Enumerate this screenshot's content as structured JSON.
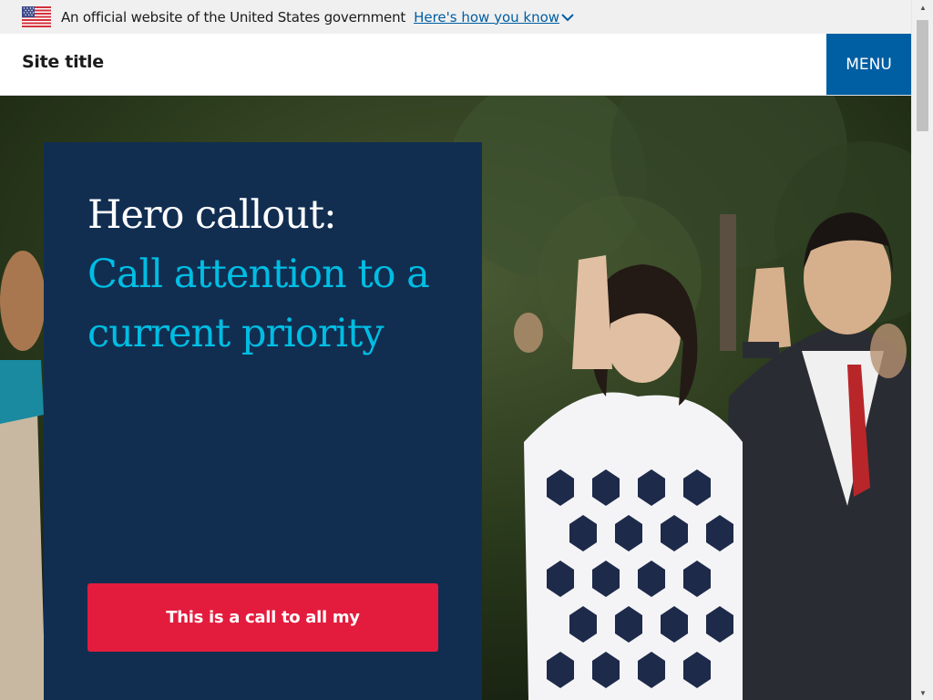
{
  "gov_banner": {
    "text": "An official website of the United States government",
    "link_label": "Here's how you know"
  },
  "header": {
    "site_title": "Site title",
    "menu_label": "MENU"
  },
  "hero": {
    "callout_label": "Hero callout:",
    "callout_text": "Call attention to a current priority",
    "button_label": "This is a call to all my"
  },
  "colors": {
    "primary": "#005ea2",
    "callout_bg": "#112e51",
    "callout_accent": "#00bde3",
    "cta": "#e31c3d"
  }
}
